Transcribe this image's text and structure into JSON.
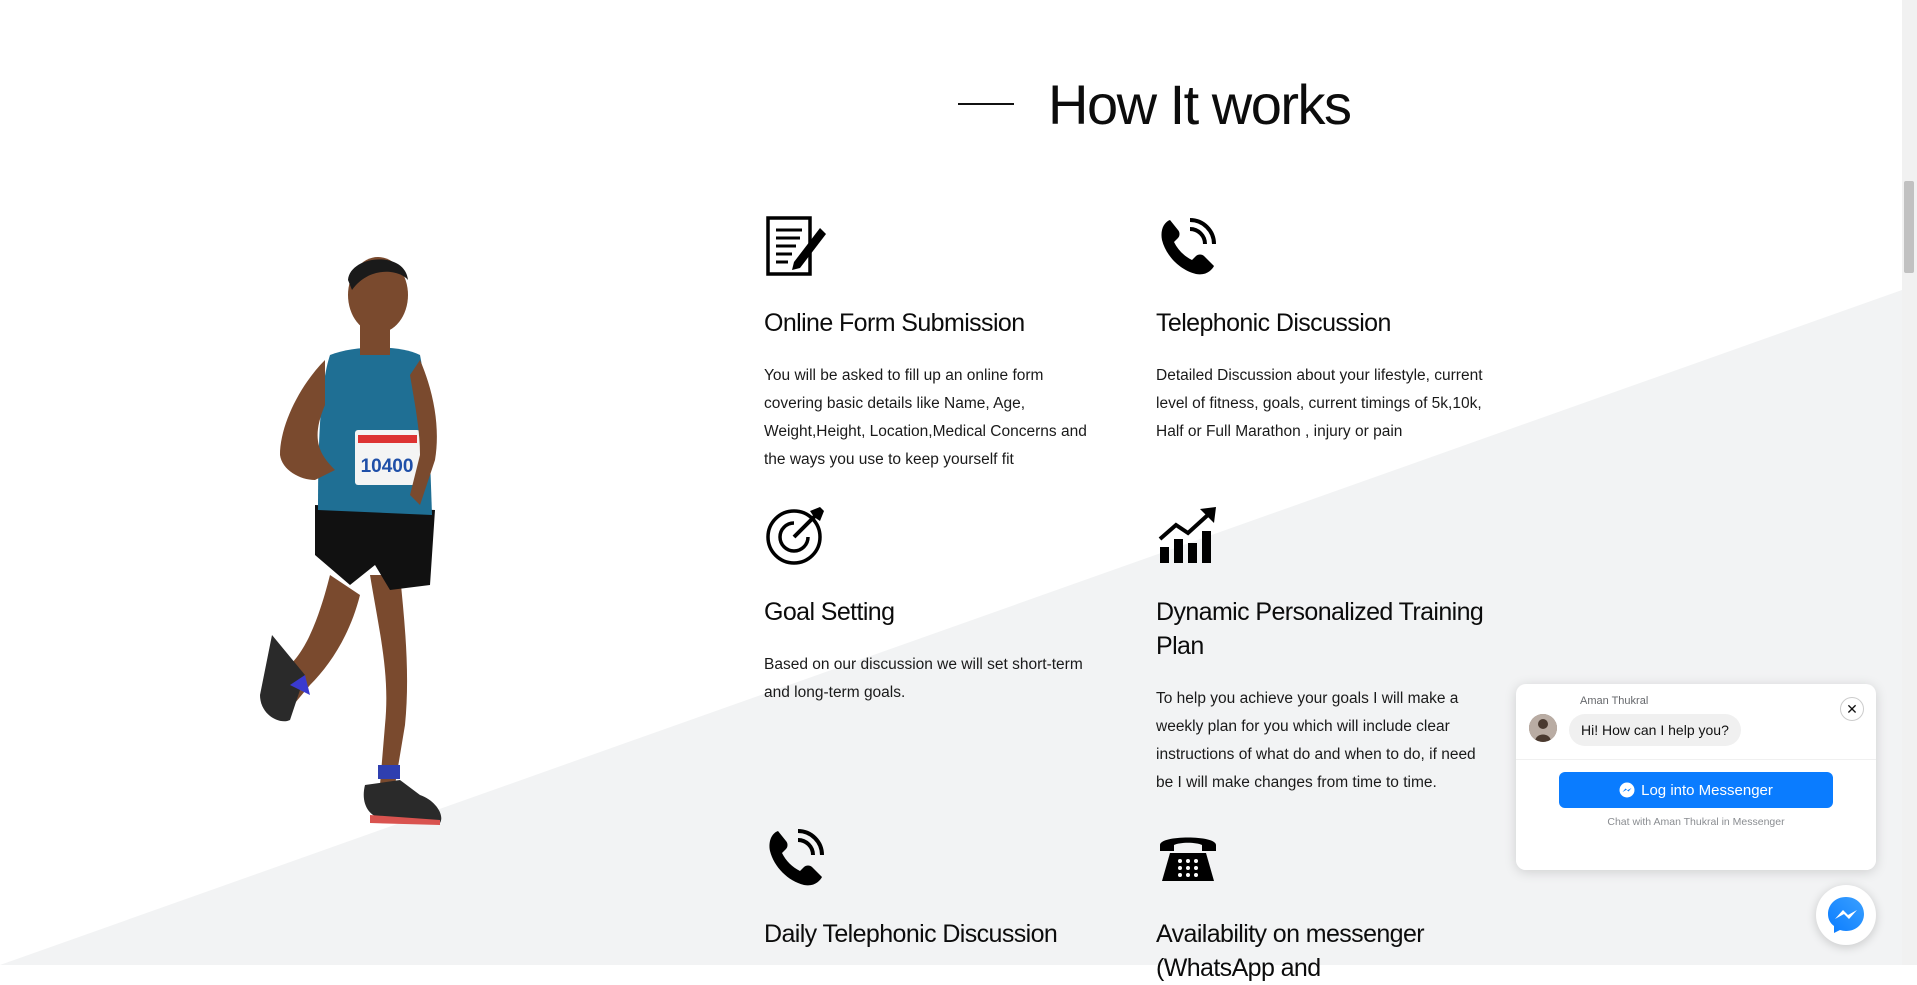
{
  "section": {
    "heading": "How It works"
  },
  "features": [
    {
      "icon": "form-edit-icon",
      "title": "Online Form Submission",
      "description": "You will be asked to fill up an online form covering basic details like Name, Age, Weight,Height, Location,Medical Concerns and the ways you use to keep yourself fit"
    },
    {
      "icon": "phone-call-icon",
      "title": "Telephonic Discussion",
      "description": "Detailed Discussion about your lifestyle, current level of fitness, goals, current timings of 5k,10k, Half or Full Marathon , injury or pain"
    },
    {
      "icon": "target-icon",
      "title": "Goal Setting",
      "description": "Based on our discussion we will set short-term and long-term goals."
    },
    {
      "icon": "growth-chart-icon",
      "title": "Dynamic Personalized Training Plan",
      "description": "To help you achieve your goals I will make a weekly plan for you which will include clear instructions of what do and when to do, if need be I will make changes from time to time."
    },
    {
      "icon": "phone-call-icon",
      "title": "Daily Telephonic Discussion"
    },
    {
      "icon": "telephone-icon",
      "title": "Availability on messenger (WhatsApp and"
    }
  ],
  "runner_image": {
    "bib_number": "10400"
  },
  "messenger": {
    "sender": "Aman Thukral",
    "greeting": "Hi! How can I help you?",
    "close_symbol": "✕",
    "login_label": "Log into Messenger",
    "footer": "Chat with Aman Thukral in Messenger"
  },
  "colors": {
    "diagonal_bg": "#f2f3f4",
    "messenger_blue": "#0a7cff",
    "text": "#0c0c0c"
  }
}
